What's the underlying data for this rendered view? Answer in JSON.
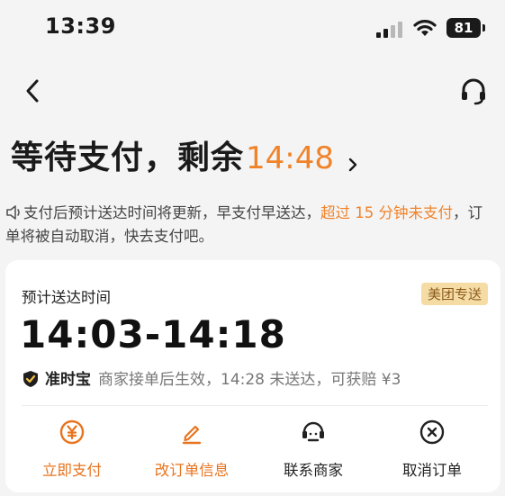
{
  "status_bar": {
    "time": "13:39",
    "battery": "81"
  },
  "header": {
    "title": "等待支付，剩余",
    "countdown": "14:48"
  },
  "notice": {
    "text_before": "支付后预计送达时间将更新，早支付早送达，",
    "highlight": "超过 15 分钟未支付",
    "text_after": "，订单将被自动取消，快去支付吧。"
  },
  "card": {
    "eta_label": "预计送达时间",
    "delivery_tag": "美团专送",
    "eta_time": "14:03-14:18",
    "guarantee_brand": "准时宝",
    "guarantee_desc": "商家接单后生效，14:28 未送达，可获赔 ¥3"
  },
  "actions": [
    {
      "label": "立即支付",
      "icon": "yen-circle-icon"
    },
    {
      "label": "改订单信息",
      "icon": "pencil-icon"
    },
    {
      "label": "联系商家",
      "icon": "merchant-chat-icon"
    },
    {
      "label": "取消订单",
      "icon": "close-circle-icon"
    }
  ],
  "colors": {
    "accent": "#f0832a",
    "action_orange": "#e8741f",
    "tag_bg": "#f5dca4"
  }
}
